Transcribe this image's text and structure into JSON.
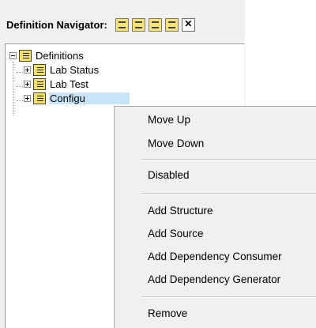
{
  "navigator": {
    "title": "Definition Navigator:",
    "icons": [
      "new-definition-icon",
      "expand-icon",
      "collapse-icon",
      "properties-icon",
      "close-icon"
    ]
  },
  "tree": {
    "root": {
      "label": "Definitions",
      "icon": "definitions-folder-icon",
      "expanded": true
    },
    "children": [
      {
        "label": "Lab Status",
        "icon": "definition-icon",
        "expanded": false
      },
      {
        "label": "Lab Test",
        "icon": "definition-icon",
        "expanded": false
      },
      {
        "label": "Configu",
        "icon": "definition-icon",
        "expanded": false,
        "selected": true
      }
    ]
  },
  "context_menu": {
    "items": [
      {
        "label": "Move Up"
      },
      {
        "label": "Move Down"
      },
      {
        "label": "Disabled"
      },
      {
        "label": "Add Structure"
      },
      {
        "label": "Add Source"
      },
      {
        "label": "Add Dependency Consumer"
      },
      {
        "label": "Add Dependency Generator"
      },
      {
        "label": "Remove"
      }
    ]
  }
}
